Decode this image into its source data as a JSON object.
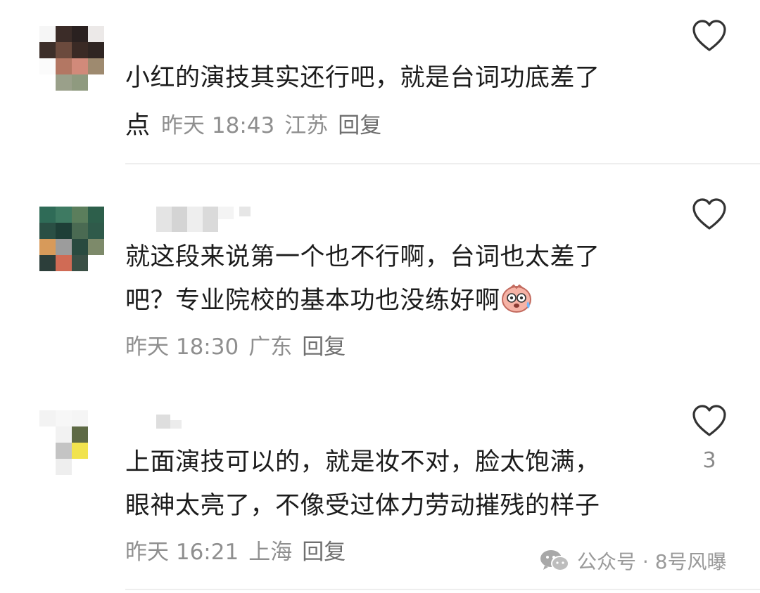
{
  "comments": [
    {
      "text": "小红的演技其实还行吧，就是台词功底差了",
      "text_tail": "点",
      "time": "昨天 18:43",
      "location": "江苏",
      "reply_label": "回复",
      "like_count": ""
    },
    {
      "text_line1": "就这段来说第一个也不行啊，台词也太差了",
      "text_line2": "吧？专业院校的基本功也没练好啊",
      "emoji": "shocked-face-emoji",
      "time": "昨天 18:30",
      "location": "广东",
      "reply_label": "回复",
      "like_count": ""
    },
    {
      "text_line1": "上面演技可以的，就是妆不对，脸太饱满，",
      "text_line2": "眼神太亮了，不像受过体力劳动摧残的样子",
      "time": "昨天 16:21",
      "location": "上海",
      "reply_label": "回复",
      "like_count": "3"
    }
  ],
  "icons": {
    "like": "heart-outline-icon",
    "watermark": "wechat-icon"
  },
  "watermark": {
    "text": "公众号 · 8号风曝"
  },
  "colors": {
    "text": "#1c1c1c",
    "meta": "#8f8f8f",
    "icon": "#333333",
    "divider": "#eeeeee"
  }
}
